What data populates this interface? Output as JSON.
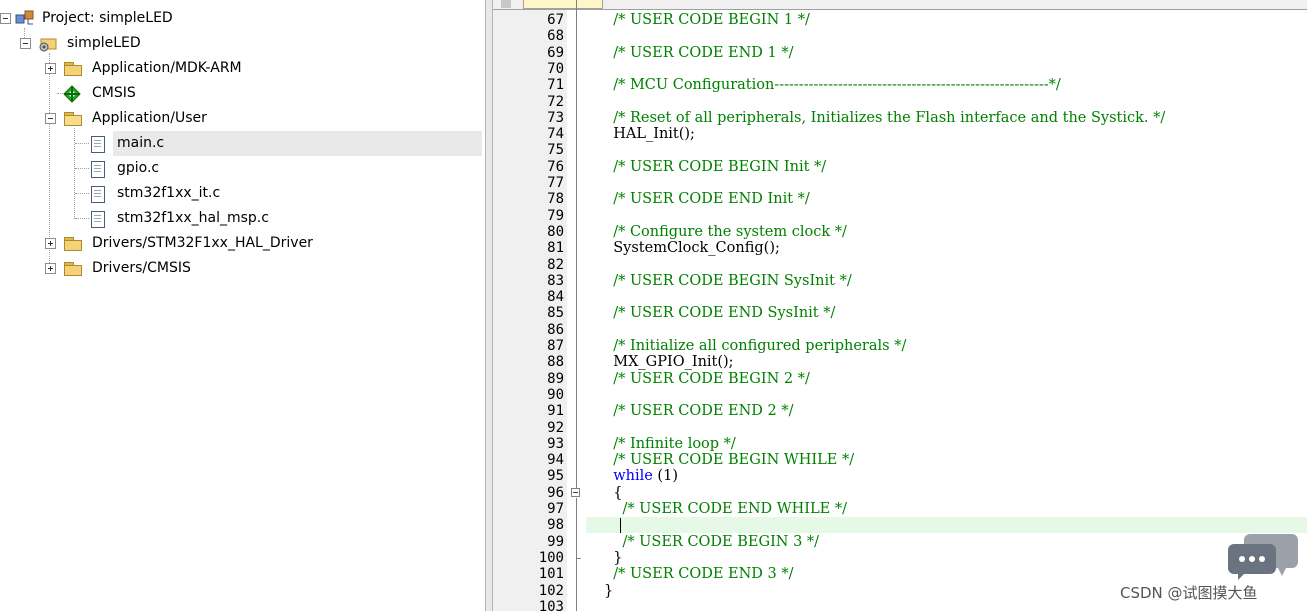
{
  "project_tree": {
    "root_label": "Project: simpleLED",
    "target_label": "simpleLED",
    "groups": [
      {
        "label": "Application/MDK-ARM",
        "expanded": false
      },
      {
        "label": "CMSIS",
        "expanded": false
      },
      {
        "label": "Application/User",
        "expanded": true
      },
      {
        "label": "Drivers/STM32F1xx_HAL_Driver",
        "expanded": false
      },
      {
        "label": "Drivers/CMSIS",
        "expanded": false
      }
    ],
    "files": [
      "main.c",
      "gpio.c",
      "stm32f1xx_it.c",
      "stm32f1xx_hal_msp.c"
    ],
    "selected_file": "main.c"
  },
  "editor": {
    "current_line": 98,
    "lines": [
      {
        "n": "67",
        "t": "  /* USER CODE BEGIN 1 */"
      },
      {
        "n": "68",
        "t": ""
      },
      {
        "n": "69",
        "t": "  /* USER CODE END 1 */"
      },
      {
        "n": "70",
        "t": ""
      },
      {
        "n": "71",
        "t": "  /* MCU Configuration--------------------------------------------------------*/"
      },
      {
        "n": "72",
        "t": ""
      },
      {
        "n": "73",
        "t": "  /* Reset of all peripherals, Initializes the Flash interface and the Systick. */"
      },
      {
        "n": "74",
        "t": "  HAL_Init();"
      },
      {
        "n": "75",
        "t": ""
      },
      {
        "n": "76",
        "t": "  /* USER CODE BEGIN Init */"
      },
      {
        "n": "77",
        "t": ""
      },
      {
        "n": "78",
        "t": "  /* USER CODE END Init */"
      },
      {
        "n": "79",
        "t": ""
      },
      {
        "n": "80",
        "t": "  /* Configure the system clock */"
      },
      {
        "n": "81",
        "t": "  SystemClock_Config();"
      },
      {
        "n": "82",
        "t": ""
      },
      {
        "n": "83",
        "t": "  /* USER CODE BEGIN SysInit */"
      },
      {
        "n": "84",
        "t": ""
      },
      {
        "n": "85",
        "t": "  /* USER CODE END SysInit */"
      },
      {
        "n": "86",
        "t": ""
      },
      {
        "n": "87",
        "t": "  /* Initialize all configured peripherals */"
      },
      {
        "n": "88",
        "t": "  MX_GPIO_Init();"
      },
      {
        "n": "89",
        "t": "  /* USER CODE BEGIN 2 */"
      },
      {
        "n": "90",
        "t": ""
      },
      {
        "n": "91",
        "t": "  /* USER CODE END 2 */"
      },
      {
        "n": "92",
        "t": ""
      },
      {
        "n": "93",
        "t": "  /* Infinite loop */"
      },
      {
        "n": "94",
        "t": "  /* USER CODE BEGIN WHILE */"
      },
      {
        "n": "95",
        "t": "  while (1)"
      },
      {
        "n": "96",
        "t": "  {"
      },
      {
        "n": "97",
        "t": "    /* USER CODE END WHILE */"
      },
      {
        "n": "98",
        "t": "    "
      },
      {
        "n": "99",
        "t": "    /* USER CODE BEGIN 3 */"
      },
      {
        "n": "100",
        "t": "  }"
      },
      {
        "n": "101",
        "t": "  /* USER CODE END 3 */"
      },
      {
        "n": "102",
        "t": "}"
      },
      {
        "n": "103",
        "t": ""
      }
    ]
  },
  "watermark": {
    "text": "CSDN @试图摸大鱼"
  },
  "colors": {
    "comment": "#008000",
    "keyword": "#0000ff",
    "gutter": "#f0f0f0",
    "current_line": "#e6f9e6"
  }
}
